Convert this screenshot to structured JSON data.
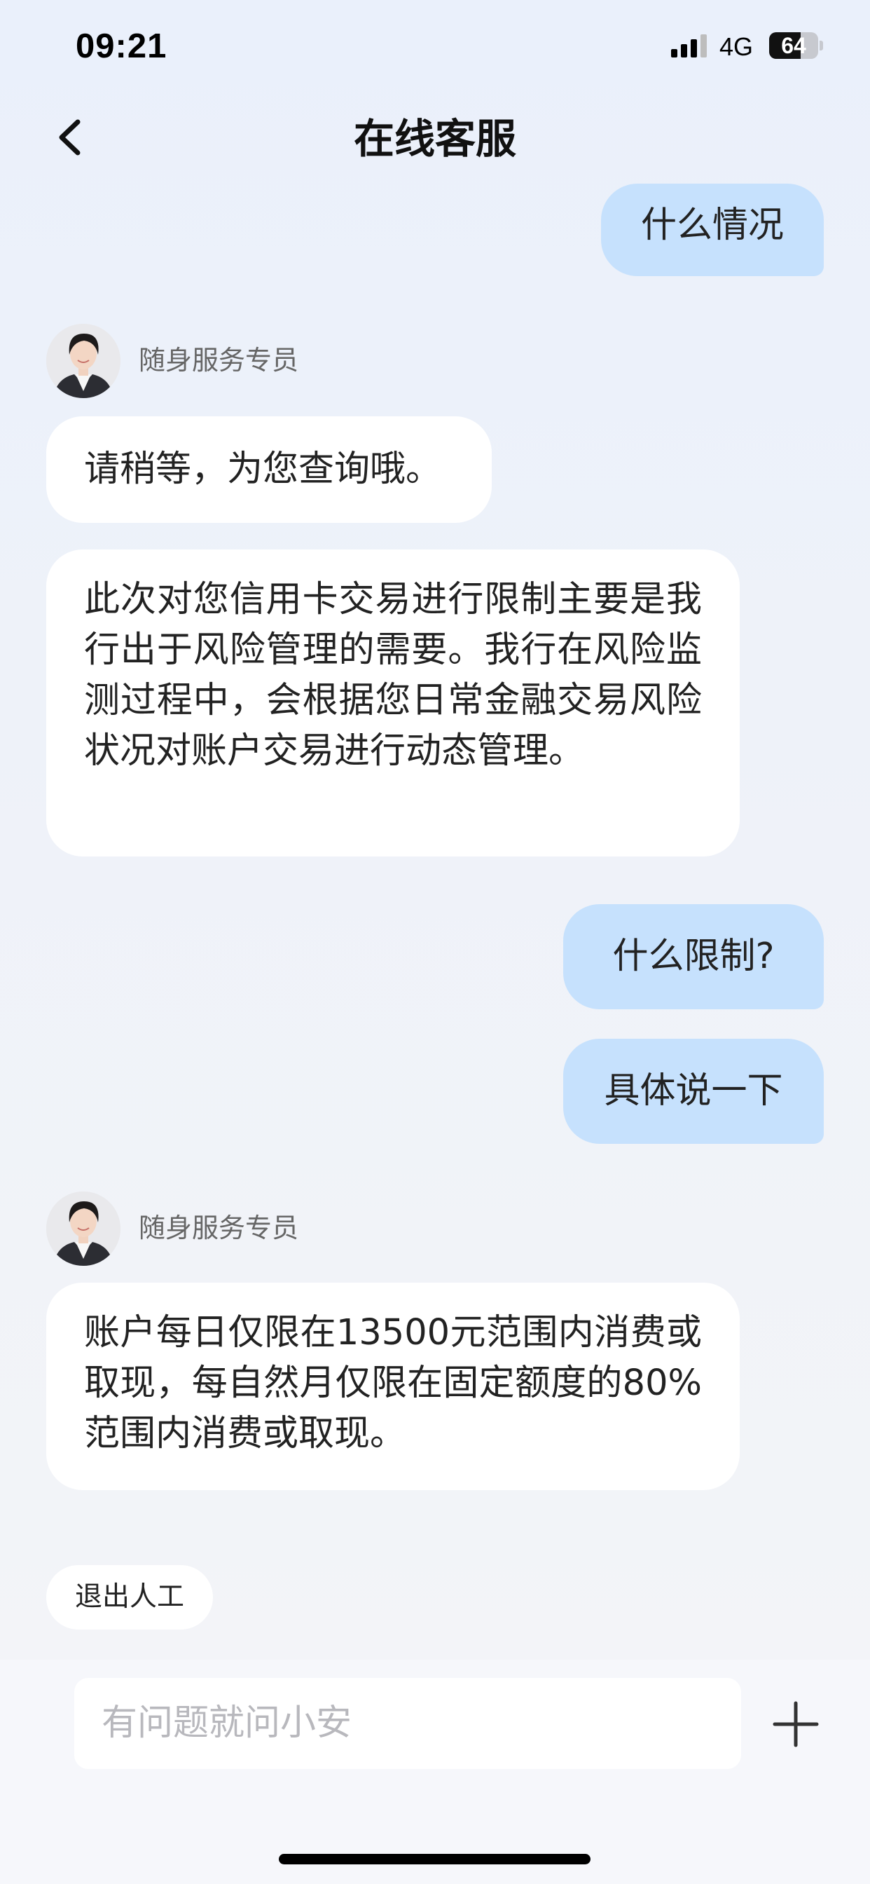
{
  "status_bar": {
    "time": "09:21",
    "network": "4G",
    "battery": "64",
    "battery_level": 0.64
  },
  "header": {
    "title": "在线客服"
  },
  "agent_name": "随身服务专员",
  "messages": [
    {
      "role": "user",
      "text": "什么情况"
    },
    {
      "role": "agent",
      "text": "请稍等，为您查询哦。"
    },
    {
      "role": "agent",
      "text": "此次对您信用卡交易进行限制主要是我行出于风险管理的需要。我行在风险监测过程中，会根据您日常金融交易风险状况对账户交易进行动态管理。"
    },
    {
      "role": "user",
      "text": "什么限制?"
    },
    {
      "role": "user",
      "text": "具体说一下"
    },
    {
      "role": "agent",
      "text": "账户每日仅限在13500元范围内消费或取现，每自然月仅限在固定额度的80%范围内消费或取现。"
    }
  ],
  "exit_button": "退出人工",
  "input": {
    "placeholder": "有问题就问小安"
  },
  "icons": {
    "back": "chevron-left-icon",
    "add": "plus-icon",
    "avatar": "agent-avatar"
  },
  "colors": {
    "user_bubble": "#c6e1fd",
    "agent_bubble": "#ffffff",
    "background": "#eaf0fb"
  }
}
